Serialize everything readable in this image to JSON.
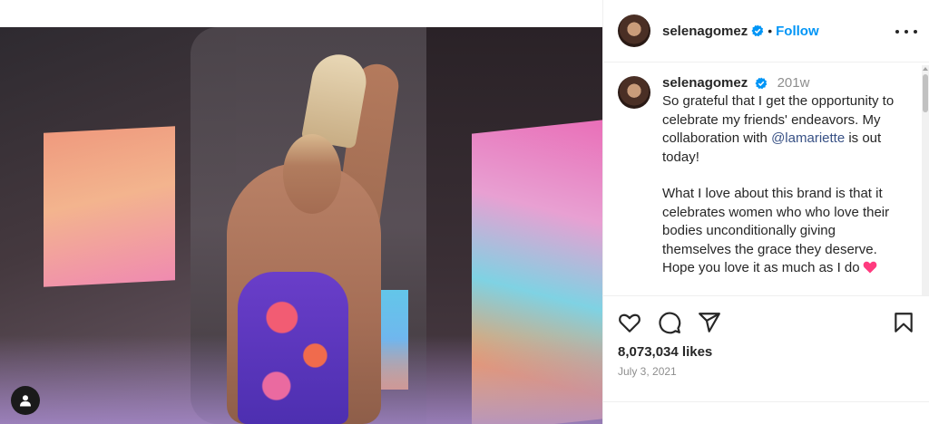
{
  "post": {
    "username": "selenagomez",
    "follow_label": "Follow",
    "separator": "•"
  },
  "caption": {
    "username": "selenagomez",
    "age": "201w",
    "line_1": "So grateful that I get the opportunity to celebrate my friends' endeavors. My collaboration with ",
    "mention": "@lamariette",
    "line_1_end": " is out today!",
    "paragraph_2": "What I love about this brand is that it celebrates women who who love their bodies unconditionally giving themselves the grace they deserve. Hope you love it as much as I do"
  },
  "stats": {
    "likes": "8,073,034 likes",
    "date": "July 3, 2021"
  },
  "icons": {
    "like": "heart-outline-icon",
    "comment": "comment-bubble-icon",
    "share": "paper-plane-icon",
    "save": "bookmark-icon",
    "more": "more-horizontal-icon",
    "verified": "verified-badge-icon",
    "account": "account-user-icon"
  },
  "colors": {
    "follow": "#0095f6",
    "verified": "#0095f6",
    "mention": "#385185",
    "heart_emoji": "#ff3b7f",
    "muted_text": "#8e8e8e"
  }
}
